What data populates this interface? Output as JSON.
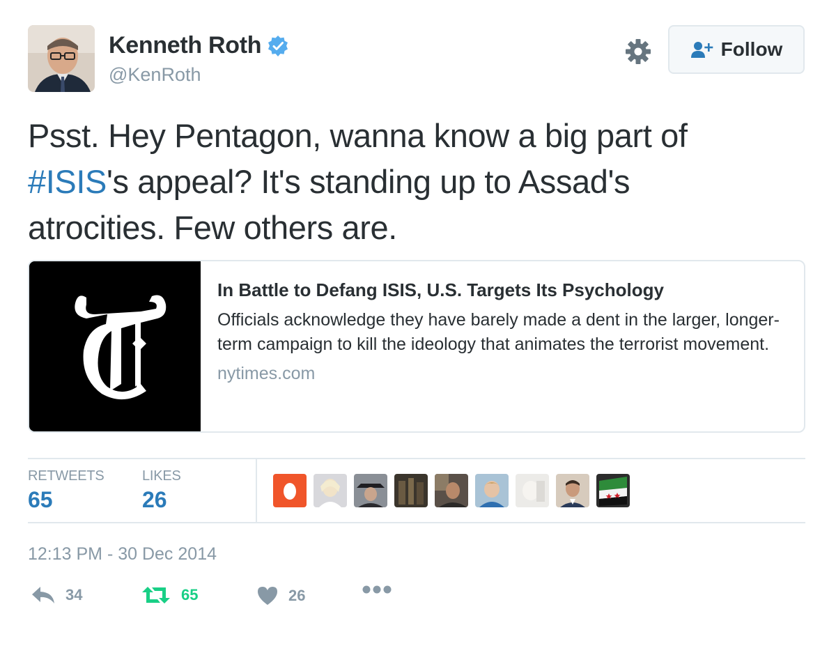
{
  "header": {
    "display_name": "Kenneth Roth",
    "handle": "@KenRoth",
    "follow_label": "Follow"
  },
  "tweet": {
    "text_line1": "Psst. Hey Pentagon, wanna know a big part of",
    "hashtag": "#ISIS",
    "text_line2_rest": "'s appeal? It's standing up to Assad's",
    "text_line3": "atrocities. Few others are."
  },
  "card": {
    "title": "In Battle to Defang ISIS, U.S. Targets Its Psychology",
    "description": "Officials acknowledge they have barely made a dent in the larger, longer-term campaign to kill the ideology that animates the terrorist movement.",
    "domain": "nytimes.com"
  },
  "stats": {
    "retweets_label": "RETWEETS",
    "retweets_value": "65",
    "likes_label": "LIKES",
    "likes_value": "26"
  },
  "timestamp": "12:13 PM - 30 Dec 2014",
  "actions": {
    "reply_count": "34",
    "retweet_count": "65",
    "like_count": "26"
  },
  "colors": {
    "link_blue": "#2b7bb9",
    "retweet_green": "#19cf86",
    "muted_gray": "#8899a6",
    "text": "#292f33"
  },
  "icons": [
    "verified-badge-icon",
    "gear-icon",
    "follow-user-icon",
    "reply-icon",
    "retweet-icon",
    "heart-icon",
    "more-icon"
  ]
}
